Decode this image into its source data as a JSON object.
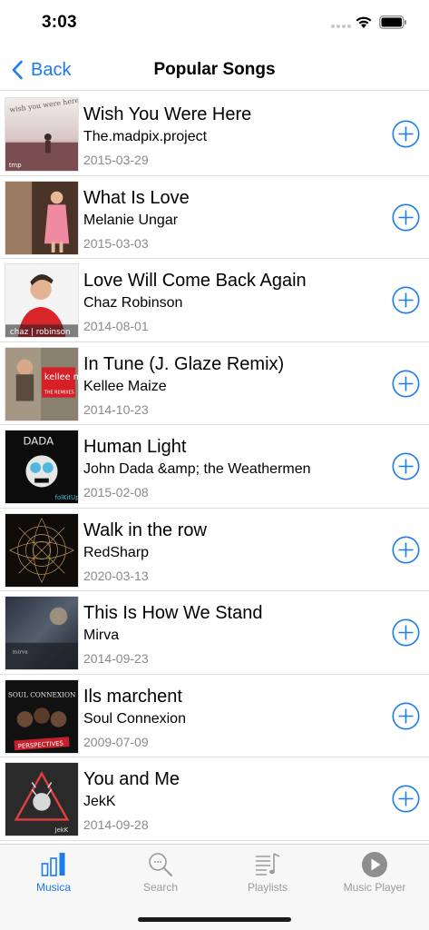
{
  "status_bar": {
    "time": "3:03"
  },
  "nav": {
    "back_label": "Back",
    "title": "Popular Songs"
  },
  "colors": {
    "accent": "#1a7cf0",
    "secondary_text": "#8a8a8a",
    "inactive_tab": "#9a9a9a"
  },
  "songs": [
    {
      "title": "Wish You Were Here",
      "artist": "The.madpix.project",
      "date": "2015-03-29",
      "art_text": "wish you were here",
      "art_badge": "tmp"
    },
    {
      "title": "What Is Love",
      "artist": "Melanie Ungar",
      "date": "2015-03-03",
      "art_text": "",
      "art_badge": ""
    },
    {
      "title": "Love Will Come Back Again",
      "artist": "Chaz Robinson",
      "date": "2014-08-01",
      "art_text": "chaz | robinson",
      "art_badge": ""
    },
    {
      "title": "In Tune (J. Glaze Remix)",
      "artist": "Kellee Maize",
      "date": "2014-10-23",
      "art_text": "kellee maize",
      "art_badge": "THE REMIXES"
    },
    {
      "title": "Human Light",
      "artist": "John Dada &amp; the Weathermen",
      "date": "2015-02-08",
      "art_text": "DADA",
      "art_badge": "folKitUp"
    },
    {
      "title": "Walk in the row",
      "artist": "RedSharp",
      "date": "2020-03-13",
      "art_text": "",
      "art_badge": ""
    },
    {
      "title": "This Is How We Stand",
      "artist": "Mirva",
      "date": "2014-09-23",
      "art_text": "mirva",
      "art_badge": ""
    },
    {
      "title": "Ils marchent",
      "artist": "Soul Connexion",
      "date": "2009-07-09",
      "art_text": "SOUL CONNEXION",
      "art_badge": "PERSPECTIVES"
    },
    {
      "title": "You and Me",
      "artist": "JekK",
      "date": "2014-09-28",
      "art_text": "JekK",
      "art_badge": ""
    }
  ],
  "tabs": [
    {
      "label": "Musica",
      "icon": "bar-chart-icon",
      "active": true
    },
    {
      "label": "Search",
      "icon": "search-icon",
      "active": false
    },
    {
      "label": "Playlists",
      "icon": "playlist-icon",
      "active": false
    },
    {
      "label": "Music Player",
      "icon": "play-circle-icon",
      "active": false
    }
  ]
}
